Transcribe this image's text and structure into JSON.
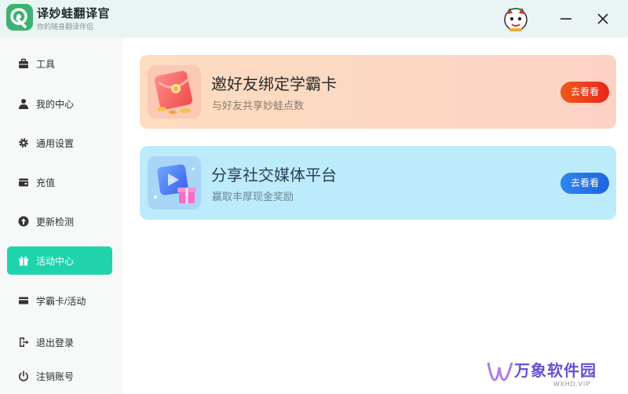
{
  "app": {
    "name": "译妙蛙翻译官",
    "slogan": "你的随身翻译伴侣"
  },
  "window": {
    "minimize_icon": "minimize-icon",
    "close_icon": "close-icon"
  },
  "sidebar": {
    "items": [
      {
        "label": "工具",
        "icon": "briefcase-icon"
      },
      {
        "label": "我的中心",
        "icon": "user-icon"
      },
      {
        "label": "通用设置",
        "icon": "gear-icon"
      },
      {
        "label": "充值",
        "icon": "wallet-icon"
      },
      {
        "label": "更新检测",
        "icon": "update-icon"
      },
      {
        "label": "活动中心",
        "icon": "gift-icon",
        "active": true
      },
      {
        "label": "学霸卡/活动",
        "icon": "card-icon"
      },
      {
        "label": "退出登录",
        "icon": "logout-icon"
      },
      {
        "label": "注销账号",
        "icon": "power-icon"
      }
    ]
  },
  "cards": [
    {
      "title": "邀好友绑定学霸卡",
      "subtitle": "与好友共享妙蛙点数",
      "button": "去看看",
      "thumb": "red-envelope-icon"
    },
    {
      "title": "分享社交媒体平台",
      "subtitle": "赢取丰厚现金奖励",
      "button": "去看看",
      "thumb": "share-gift-icon"
    }
  ],
  "watermark": {
    "text": "万象软件园",
    "domain": "WXHD.VIP"
  },
  "colors": {
    "accent": "#1fd3ad",
    "brand_green": "#3db372",
    "orange_button": "#ed3d1c",
    "blue_button": "#2a78ea"
  }
}
